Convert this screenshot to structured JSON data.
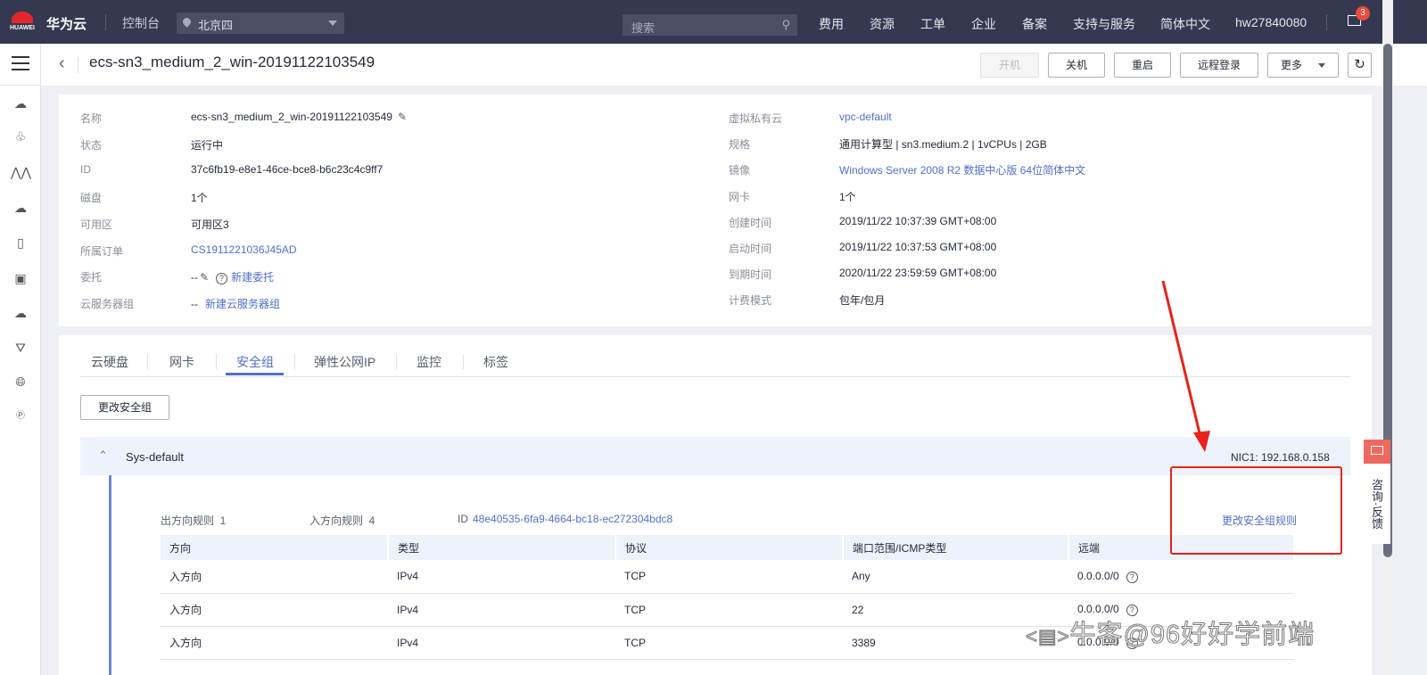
{
  "topbar": {
    "logo_text": "HUAWEI",
    "brand": "华为云",
    "console": "控制台",
    "region": "北京四",
    "search_placeholder": "搜索",
    "nav": [
      "费用",
      "资源",
      "工单",
      "企业",
      "备案",
      "支持与服务",
      "简体中文",
      "hw27840080"
    ],
    "mail_badge": "3"
  },
  "sidebar": {
    "icons": [
      "cloud-server-icon",
      "cluster-icon",
      "auto-scaling-icon",
      "bare-metal-icon",
      "dedicated-host-icon",
      "image-icon",
      "cloud-backup-icon",
      "vpc-icon",
      "network-icon",
      "eip-icon"
    ]
  },
  "header": {
    "title": "ecs-sn3_medium_2_win-20191122103549",
    "buttons": {
      "start": "开机",
      "stop": "关机",
      "restart": "重启",
      "remote": "远程登录",
      "more": "更多"
    }
  },
  "details": {
    "left": [
      {
        "label": "名称",
        "value": "ecs-sn3_medium_2_win-20191122103549"
      },
      {
        "label": "状态",
        "value": "运行中"
      },
      {
        "label": "ID",
        "value": "37c6fb19-e8e1-46ce-bce8-b6c23c4c9ff7"
      },
      {
        "label": "磁盘",
        "value": "1个"
      },
      {
        "label": "可用区",
        "value": "可用区3"
      },
      {
        "label": "所属订单",
        "value": "CS1911221036J45AD"
      },
      {
        "label": "委托",
        "value": "--",
        "link": "新建委托"
      },
      {
        "label": "云服务器组",
        "value": "--",
        "link": "新建云服务器组"
      }
    ],
    "right": [
      {
        "label": "虚拟私有云",
        "value": "vpc-default"
      },
      {
        "label": "规格",
        "value": "通用计算型 | sn3.medium.2 | 1vCPUs | 2GB"
      },
      {
        "label": "镜像",
        "value": "Windows Server 2008 R2 数据中心版 64位简体中文"
      },
      {
        "label": "网卡",
        "value": "1个"
      },
      {
        "label": "创建时间",
        "value": "2019/11/22 10:37:39 GMT+08:00"
      },
      {
        "label": "启动时间",
        "value": "2019/11/22 10:37:53 GMT+08:00"
      },
      {
        "label": "到期时间",
        "value": "2020/11/22 23:59:59 GMT+08:00"
      },
      {
        "label": "计费模式",
        "value": "包年/包月"
      }
    ]
  },
  "tabs": [
    "云硬盘",
    "网卡",
    "安全组",
    "弹性公网IP",
    "监控",
    "标签"
  ],
  "security": {
    "change_button": "更改安全组",
    "group_name": "Sys-default",
    "nic": "NIC1: 192.168.0.158",
    "outbound": "出方向规则  1",
    "inbound": "入方向规则  4",
    "id_label": "ID",
    "id": "48e40535-6fa9-4664-bc18-ec272304bdc8",
    "change_rules": "更改安全组规则",
    "columns": [
      "方向",
      "类型",
      "协议",
      "端口范围/ICMP类型",
      "远端"
    ],
    "rows": [
      [
        "入方向",
        "IPv4",
        "TCP",
        "Any",
        "0.0.0.0/0"
      ],
      [
        "入方向",
        "IPv4",
        "TCP",
        "22",
        "0.0.0.0/0"
      ],
      [
        "入方向",
        "IPv4",
        "TCP",
        "3389",
        "0.0.0.0/0"
      ]
    ]
  },
  "feedback": "咨询·反馈",
  "watermark": "牛客@96好好学前端",
  "colors": {
    "accent": "#526ecc",
    "topbar": "#343850",
    "annotation": "#e8221b"
  }
}
